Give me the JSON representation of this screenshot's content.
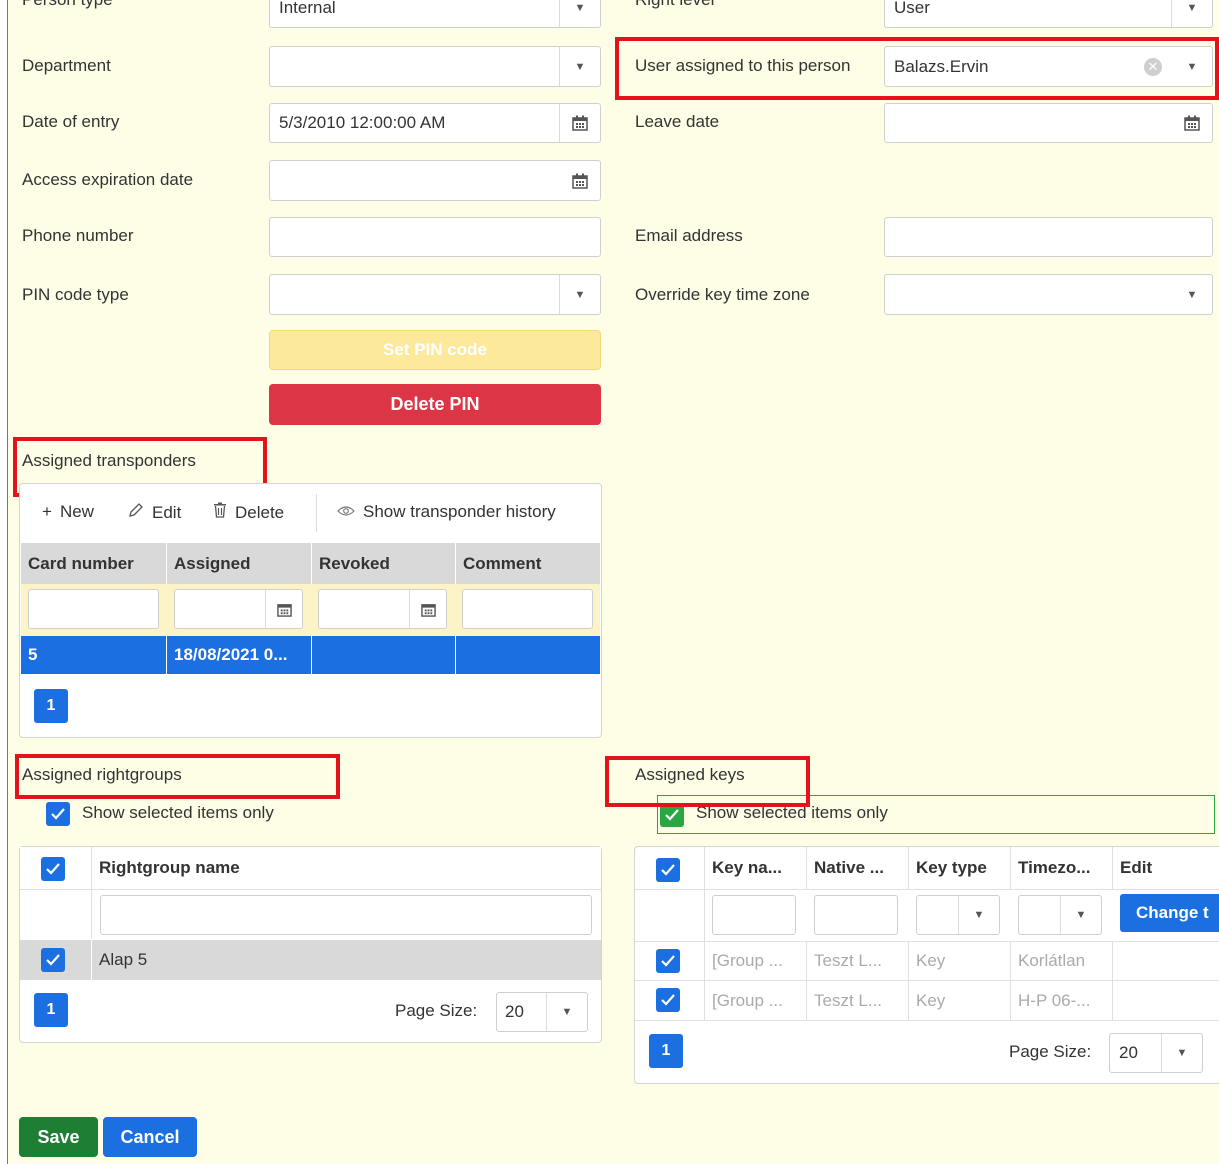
{
  "form": {
    "top_left_label": "Person type",
    "top_left_value": "Internal",
    "top_right_label": "Right level",
    "top_right_value": "User",
    "department_label": "Department",
    "department_value": "",
    "user_assigned_label": "User assigned to this person",
    "user_assigned_value": "Balazs.Ervin",
    "date_entry_label": "Date of entry",
    "date_entry_value": "5/3/2010 12:00:00 AM",
    "leave_date_label": "Leave date",
    "leave_date_value": "",
    "access_exp_label": "Access expiration date",
    "phone_label": "Phone number",
    "email_label": "Email address",
    "pin_type_label": "PIN code type",
    "override_tz_label": "Override key time zone",
    "set_pin_label": "Set PIN code",
    "delete_pin_label": "Delete PIN"
  },
  "transponders": {
    "title": "Assigned transponders",
    "toolbar": {
      "new_label": "New",
      "edit_label": "Edit",
      "delete_label": "Delete",
      "history_label": "Show transponder history"
    },
    "columns": [
      "Card number",
      "Assigned",
      "Revoked",
      "Comment"
    ],
    "rows": [
      {
        "card": "5",
        "assigned": "18/08/2021 0...",
        "revoked": "",
        "comment": ""
      }
    ],
    "page": "1"
  },
  "rightgroups": {
    "title": "Assigned rightgroups",
    "show_selected_label": "Show selected items only",
    "column": "Rightgroup name",
    "rows": [
      {
        "name": "Alap 5",
        "checked": true
      }
    ],
    "page": "1",
    "page_size_label": "Page Size:",
    "page_size_value": "20"
  },
  "keys": {
    "title": "Assigned keys",
    "show_selected_label": "Show selected items only",
    "columns": [
      "Key na...",
      "Native ...",
      "Key type",
      "Timezo...",
      "Edit"
    ],
    "change_button": "Change t",
    "rows": [
      {
        "name": "[Group ...",
        "native": "Teszt L...",
        "type": "Key",
        "tz": "Korlátlan"
      },
      {
        "name": "[Group ...",
        "native": "Teszt L...",
        "type": "Key",
        "tz": "H-P 06-..."
      }
    ],
    "page": "1",
    "page_size_label": "Page Size:",
    "page_size_value": "20"
  },
  "footer": {
    "save_label": "Save",
    "cancel_label": "Cancel"
  },
  "colors": {
    "accent": "#1c6fe0",
    "danger": "#dc3545",
    "success": "#1e7e34",
    "highlight": "#e3121b",
    "background": "#fefde6"
  }
}
